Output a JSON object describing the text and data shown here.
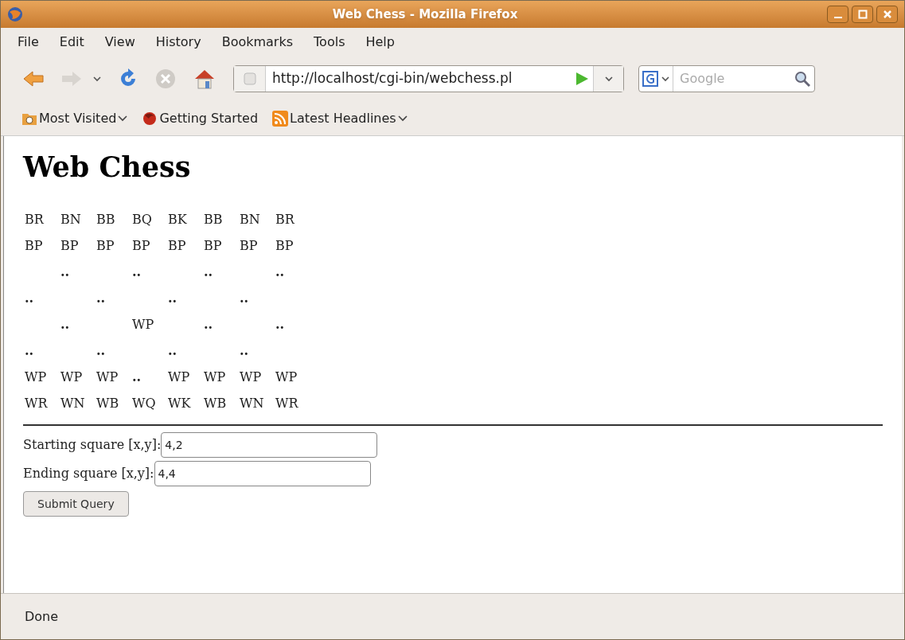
{
  "window": {
    "title": "Web Chess - Mozilla Firefox"
  },
  "menu": [
    "File",
    "Edit",
    "View",
    "History",
    "Bookmarks",
    "Tools",
    "Help"
  ],
  "address": {
    "value": "http://localhost/cgi-bin/webchess.pl"
  },
  "search": {
    "placeholder": "Google"
  },
  "bookmarks": [
    {
      "label": "Most Visited",
      "kind": "folder",
      "dropdown": true
    },
    {
      "label": "Getting Started",
      "kind": "page",
      "dropdown": false
    },
    {
      "label": "Latest Headlines",
      "kind": "feed",
      "dropdown": true
    }
  ],
  "page": {
    "heading": "Web Chess",
    "board": [
      [
        {
          "kind": "piece",
          "text": "BR"
        },
        {
          "kind": "piece",
          "text": "BN"
        },
        {
          "kind": "piece",
          "text": "BB"
        },
        {
          "kind": "piece",
          "text": "BQ"
        },
        {
          "kind": "piece",
          "text": "BK"
        },
        {
          "kind": "piece",
          "text": "BB"
        },
        {
          "kind": "piece",
          "text": "BN"
        },
        {
          "kind": "piece",
          "text": "BR"
        }
      ],
      [
        {
          "kind": "piece",
          "text": "BP"
        },
        {
          "kind": "piece",
          "text": "BP"
        },
        {
          "kind": "piece",
          "text": "BP"
        },
        {
          "kind": "piece",
          "text": "BP"
        },
        {
          "kind": "piece",
          "text": "BP"
        },
        {
          "kind": "piece",
          "text": "BP"
        },
        {
          "kind": "piece",
          "text": "BP"
        },
        {
          "kind": "piece",
          "text": "BP"
        }
      ],
      [
        {
          "kind": "blank"
        },
        {
          "kind": "marker",
          "text": ".."
        },
        {
          "kind": "blank"
        },
        {
          "kind": "marker",
          "text": ".."
        },
        {
          "kind": "blank"
        },
        {
          "kind": "marker",
          "text": ".."
        },
        {
          "kind": "blank"
        },
        {
          "kind": "marker",
          "text": ".."
        }
      ],
      [
        {
          "kind": "marker",
          "text": ".."
        },
        {
          "kind": "blank"
        },
        {
          "kind": "marker",
          "text": ".."
        },
        {
          "kind": "blank"
        },
        {
          "kind": "marker",
          "text": ".."
        },
        {
          "kind": "blank"
        },
        {
          "kind": "marker",
          "text": ".."
        },
        {
          "kind": "blank"
        }
      ],
      [
        {
          "kind": "blank"
        },
        {
          "kind": "marker",
          "text": ".."
        },
        {
          "kind": "blank"
        },
        {
          "kind": "piece",
          "text": "WP"
        },
        {
          "kind": "blank"
        },
        {
          "kind": "marker",
          "text": ".."
        },
        {
          "kind": "blank"
        },
        {
          "kind": "marker",
          "text": ".."
        }
      ],
      [
        {
          "kind": "marker",
          "text": ".."
        },
        {
          "kind": "blank"
        },
        {
          "kind": "marker",
          "text": ".."
        },
        {
          "kind": "blank"
        },
        {
          "kind": "marker",
          "text": ".."
        },
        {
          "kind": "blank"
        },
        {
          "kind": "marker",
          "text": ".."
        },
        {
          "kind": "blank"
        }
      ],
      [
        {
          "kind": "piece",
          "text": "WP"
        },
        {
          "kind": "piece",
          "text": "WP"
        },
        {
          "kind": "piece",
          "text": "WP"
        },
        {
          "kind": "marker",
          "text": ".."
        },
        {
          "kind": "piece",
          "text": "WP"
        },
        {
          "kind": "piece",
          "text": "WP"
        },
        {
          "kind": "piece",
          "text": "WP"
        },
        {
          "kind": "piece",
          "text": "WP"
        }
      ],
      [
        {
          "kind": "piece",
          "text": "WR"
        },
        {
          "kind": "piece",
          "text": "WN"
        },
        {
          "kind": "piece",
          "text": "WB"
        },
        {
          "kind": "piece",
          "text": "WQ"
        },
        {
          "kind": "piece",
          "text": "WK"
        },
        {
          "kind": "piece",
          "text": "WB"
        },
        {
          "kind": "piece",
          "text": "WN"
        },
        {
          "kind": "piece",
          "text": "WR"
        }
      ]
    ],
    "fields": [
      {
        "label": "Starting square [x,y]:",
        "value": "4,2"
      },
      {
        "label": "Ending square [x,y]:",
        "value": "4,4"
      }
    ],
    "submit": "Submit Query"
  },
  "status_bar": "Done"
}
